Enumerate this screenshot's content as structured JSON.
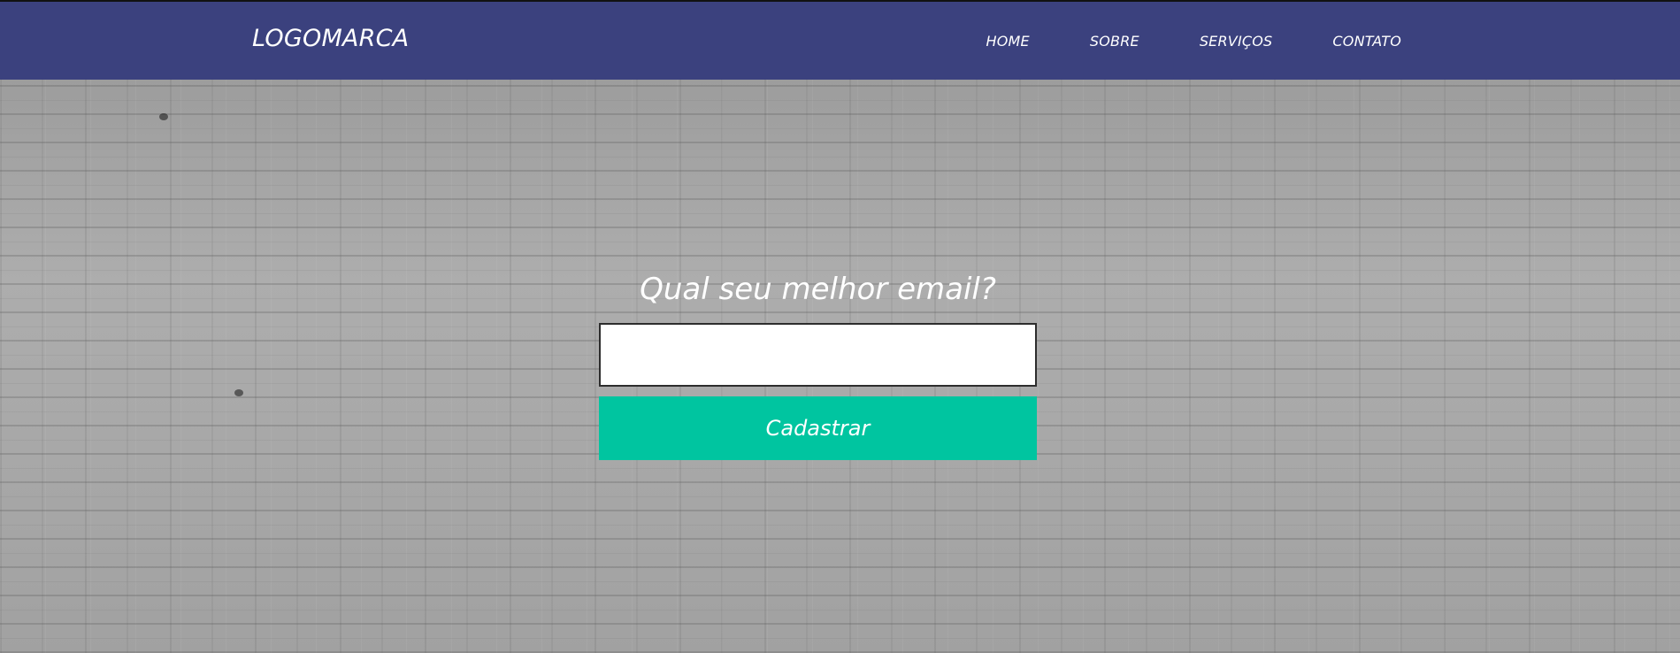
{
  "header": {
    "logo": "LOGOMARCA",
    "nav": [
      {
        "label": "HOME"
      },
      {
        "label": "SOBRE"
      },
      {
        "label": "SERVIÇOS"
      },
      {
        "label": "CONTATO"
      }
    ]
  },
  "hero": {
    "headline": "Qual seu melhor email?",
    "email_value": "",
    "button_label": "Cadastrar"
  },
  "colors": {
    "navbar": "#3b417e",
    "button": "#00c5a0",
    "background": "#a4a4a4"
  }
}
